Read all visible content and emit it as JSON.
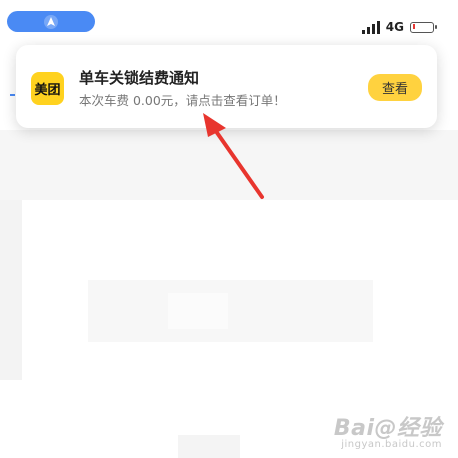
{
  "status_bar": {
    "network": "4G",
    "nav_icon": "navigation-arrow-icon",
    "signal_icon": "signal-bars-icon",
    "battery_icon": "battery-low-icon"
  },
  "notification": {
    "app_icon_text": "美团",
    "title": "单车关锁结费通知",
    "body": "本次车费 0.00元，请点击查看订单！",
    "action_label": "查看"
  },
  "annotation": {
    "icon": "red-arrow-icon",
    "color": "#e8352e"
  },
  "watermark": {
    "main": "Bai@经验",
    "sub": "jingyan.baidu.com"
  },
  "colors": {
    "brand_yellow": "#ffd21f",
    "button_yellow": "#ffd23f",
    "nav_blue": "#4a8af4"
  }
}
